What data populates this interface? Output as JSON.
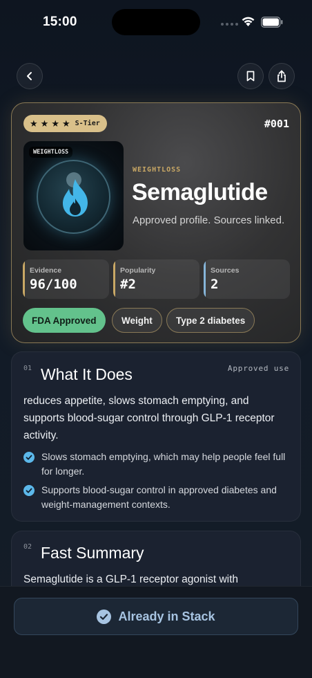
{
  "status_bar": {
    "time": "15:00"
  },
  "hero": {
    "tier_label": "S-Tier",
    "rank": "#001",
    "art_tag": "WEIGHTLOSS",
    "category": "WEIGHTLOSS",
    "title": "Semaglutide",
    "tagline": "Approved profile. Sources linked.",
    "stats": [
      {
        "label": "Evidence",
        "value": "96/100"
      },
      {
        "label": "Popularity",
        "value": "#2"
      },
      {
        "label": "Sources",
        "value": "2"
      }
    ],
    "chips": [
      "FDA Approved",
      "Weight",
      "Type 2 diabetes"
    ]
  },
  "what_it_does": {
    "number": "01",
    "title": "What It Does",
    "note": "Approved use",
    "body": "reduces appetite, slows stomach emptying, and supports blood-sugar control through GLP-1 receptor activity.",
    "bullets": [
      "Slows stomach emptying, which may help people feel full for longer.",
      "Supports blood-sugar control in approved diabetes and weight-management contexts."
    ]
  },
  "fast_summary": {
    "number": "02",
    "title": "Fast Summary",
    "body": "Semaglutide is a GLP-1 receptor agonist with"
  },
  "footer": {
    "stack_button": "Already in Stack"
  },
  "colors": {
    "accent_gold": "#c9a865",
    "fda_green": "#63c28c",
    "sources_blue": "#86b5d9",
    "flame_blue": "#43b6e8",
    "check_blue": "#5cb8ea"
  },
  "icons": [
    "back-arrow-icon",
    "bookmark-icon",
    "share-icon",
    "star-icon",
    "flame-icon",
    "check-icon",
    "check-circle-icon",
    "wifi-icon",
    "battery-icon"
  ]
}
